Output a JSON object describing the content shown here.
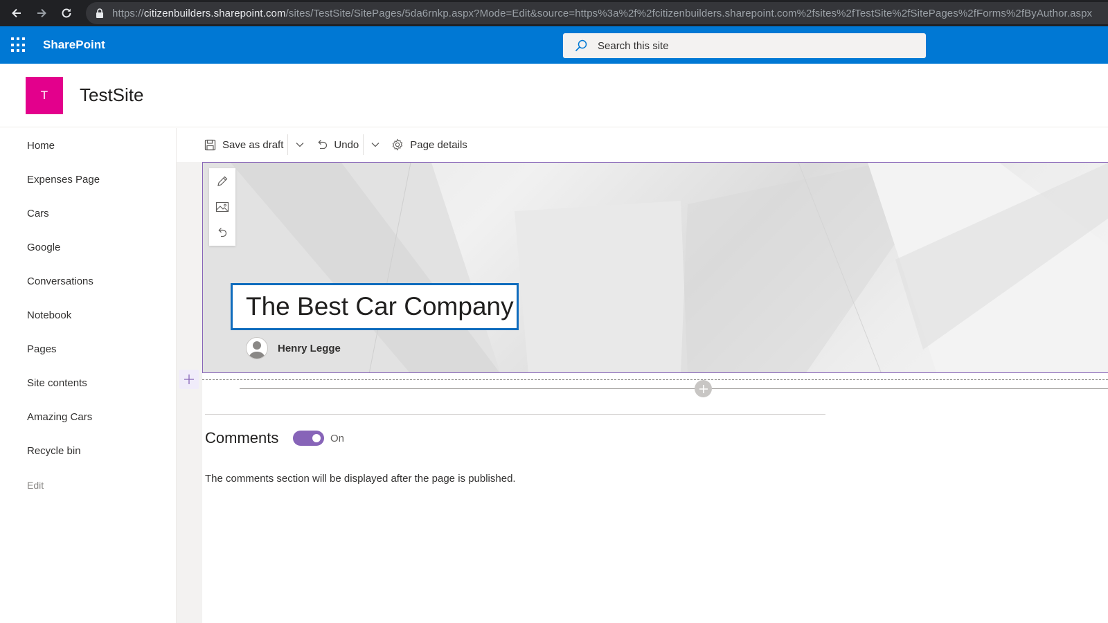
{
  "browser": {
    "url_host_prefix": "https://",
    "url_host": "citizenbuilders.sharepoint.com",
    "url_path": "/sites/TestSite/SitePages/5da6rnkp.aspx?Mode=Edit&source=https%3a%2f%2fcitizenbuilders.sharepoint.com%2fsites%2fTestSite%2fSitePages%2fForms%2fByAuthor.aspx"
  },
  "suite": {
    "brand": "SharePoint",
    "search_placeholder": "Search this site",
    "bar_color": "#0078d4"
  },
  "site": {
    "logo_letter": "T",
    "logo_color": "#e3008c",
    "title": "TestSite"
  },
  "nav": {
    "items": [
      {
        "label": "Home"
      },
      {
        "label": "Expenses Page"
      },
      {
        "label": "Cars"
      },
      {
        "label": "Google"
      },
      {
        "label": "Conversations"
      },
      {
        "label": "Notebook"
      },
      {
        "label": "Pages"
      },
      {
        "label": "Site contents"
      },
      {
        "label": "Amazing Cars"
      },
      {
        "label": "Recycle bin"
      }
    ],
    "edit_label": "Edit"
  },
  "commands": {
    "save_draft": "Save as draft",
    "undo": "Undo",
    "page_details": "Page details"
  },
  "title_region": {
    "title": "The Best Car Company",
    "author": "Henry Legge"
  },
  "comments": {
    "heading": "Comments",
    "toggle_state": "On",
    "note": "The comments section will be displayed after the page is published.",
    "accent_color": "#8764b8"
  },
  "icons": {
    "back": "back-arrow-icon",
    "forward": "forward-arrow-icon",
    "reload": "reload-icon",
    "lock": "lock-icon",
    "waffle": "app-launcher-icon",
    "search": "search-icon",
    "save": "save-icon",
    "chevron": "chevron-down-icon",
    "undo": "undo-icon",
    "settings": "gear-icon",
    "edit": "pencil-icon",
    "image": "image-icon",
    "reset": "reset-icon",
    "add": "plus-icon",
    "person": "person-icon"
  }
}
